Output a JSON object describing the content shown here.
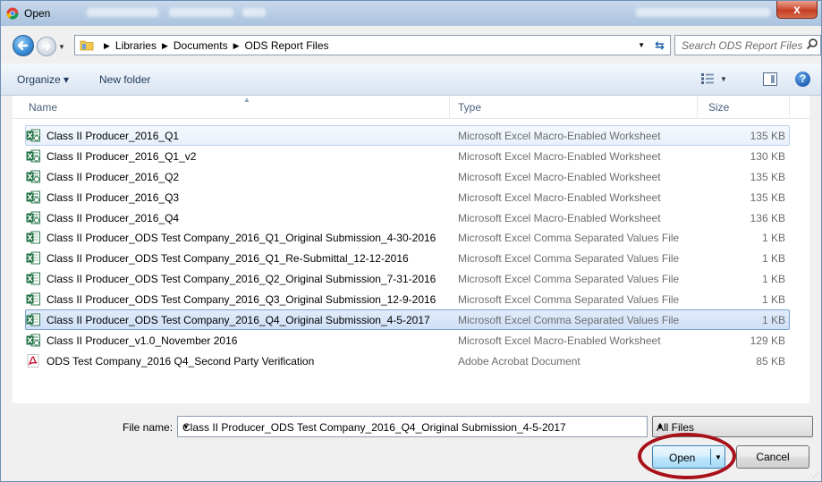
{
  "window": {
    "title": "Open",
    "close_label": "x"
  },
  "address": {
    "breadcrumbs": [
      "Libraries",
      "Documents",
      "ODS Report Files"
    ]
  },
  "search": {
    "placeholder": "Search ODS Report Files"
  },
  "toolbar": {
    "organize_label": "Organize ▾",
    "new_folder_label": "New folder"
  },
  "columns": {
    "name": "Name",
    "type": "Type",
    "size": "Size"
  },
  "files": [
    {
      "name": "Class II Producer_2016_Q1",
      "type": "Microsoft Excel Macro-Enabled Worksheet",
      "size": "135 KB",
      "icon": "excel-macro-icon"
    },
    {
      "name": "Class II Producer_2016_Q1_v2",
      "type": "Microsoft Excel Macro-Enabled Worksheet",
      "size": "130 KB",
      "icon": "excel-macro-icon"
    },
    {
      "name": "Class II Producer_2016_Q2",
      "type": "Microsoft Excel Macro-Enabled Worksheet",
      "size": "135 KB",
      "icon": "excel-macro-icon"
    },
    {
      "name": "Class II Producer_2016_Q3",
      "type": "Microsoft Excel Macro-Enabled Worksheet",
      "size": "135 KB",
      "icon": "excel-macro-icon"
    },
    {
      "name": "Class II Producer_2016_Q4",
      "type": "Microsoft Excel Macro-Enabled Worksheet",
      "size": "136 KB",
      "icon": "excel-macro-icon"
    },
    {
      "name": "Class II Producer_ODS Test Company_2016_Q1_Original Submission_4-30-2016",
      "type": "Microsoft Excel Comma Separated Values File",
      "size": "1 KB",
      "icon": "excel-csv-icon"
    },
    {
      "name": "Class II Producer_ODS Test Company_2016_Q1_Re-Submittal_12-12-2016",
      "type": "Microsoft Excel Comma Separated Values File",
      "size": "1 KB",
      "icon": "excel-csv-icon"
    },
    {
      "name": "Class II Producer_ODS Test Company_2016_Q2_Original Submission_7-31-2016",
      "type": "Microsoft Excel Comma Separated Values File",
      "size": "1 KB",
      "icon": "excel-csv-icon"
    },
    {
      "name": "Class II Producer_ODS Test Company_2016_Q3_Original Submission_12-9-2016",
      "type": "Microsoft Excel Comma Separated Values File",
      "size": "1 KB",
      "icon": "excel-csv-icon"
    },
    {
      "name": "Class II Producer_ODS Test Company_2016_Q4_Original Submission_4-5-2017",
      "type": "Microsoft Excel Comma Separated Values File",
      "size": "1 KB",
      "icon": "excel-csv-icon"
    },
    {
      "name": "Class II Producer_v1.0_November 2016",
      "type": "Microsoft Excel Macro-Enabled Worksheet",
      "size": "129 KB",
      "icon": "excel-macro-icon"
    },
    {
      "name": "ODS Test Company_2016 Q4_Second Party Verification",
      "type": "Adobe Acrobat Document",
      "size": "85 KB",
      "icon": "pdf-icon"
    }
  ],
  "selected_index": 9,
  "hover_index": 0,
  "bottom": {
    "file_name_label": "File name:",
    "file_name_value": "Class II Producer_ODS Test Company_2016_Q4_Original Submission_4-5-2017",
    "file_type_filter": "All Files",
    "open_label": "Open",
    "cancel_label": "Cancel"
  },
  "colors": {
    "highlight_ring": "#a8111a",
    "selection_border": "#7da2ce",
    "excel_green": "#1f7244"
  }
}
